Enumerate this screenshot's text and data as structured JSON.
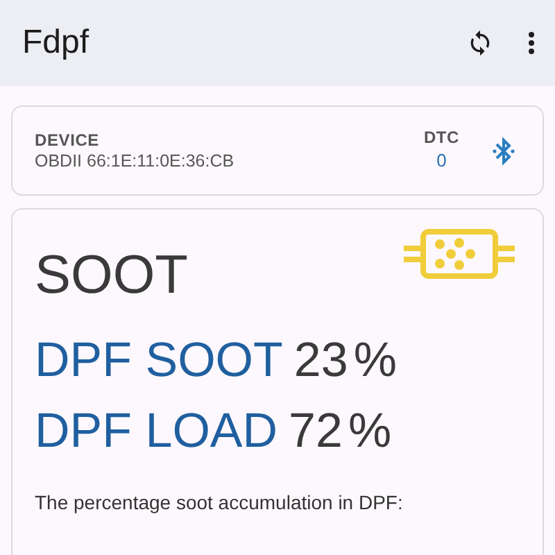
{
  "app_bar": {
    "title": "Fdpf"
  },
  "device_card": {
    "device_label": "DEVICE",
    "device_name": "OBDII 66:1E:11:0E:36:CB",
    "dtc_label": "DTC",
    "dtc_count": "0"
  },
  "soot_card": {
    "title": "SOOT",
    "metrics": [
      {
        "label": "DPF SOOT",
        "value": "23",
        "unit": "%"
      },
      {
        "label": "DPF LOAD",
        "value": "72",
        "unit": "%"
      }
    ],
    "description": "The percentage soot accumulation in DPF:"
  }
}
